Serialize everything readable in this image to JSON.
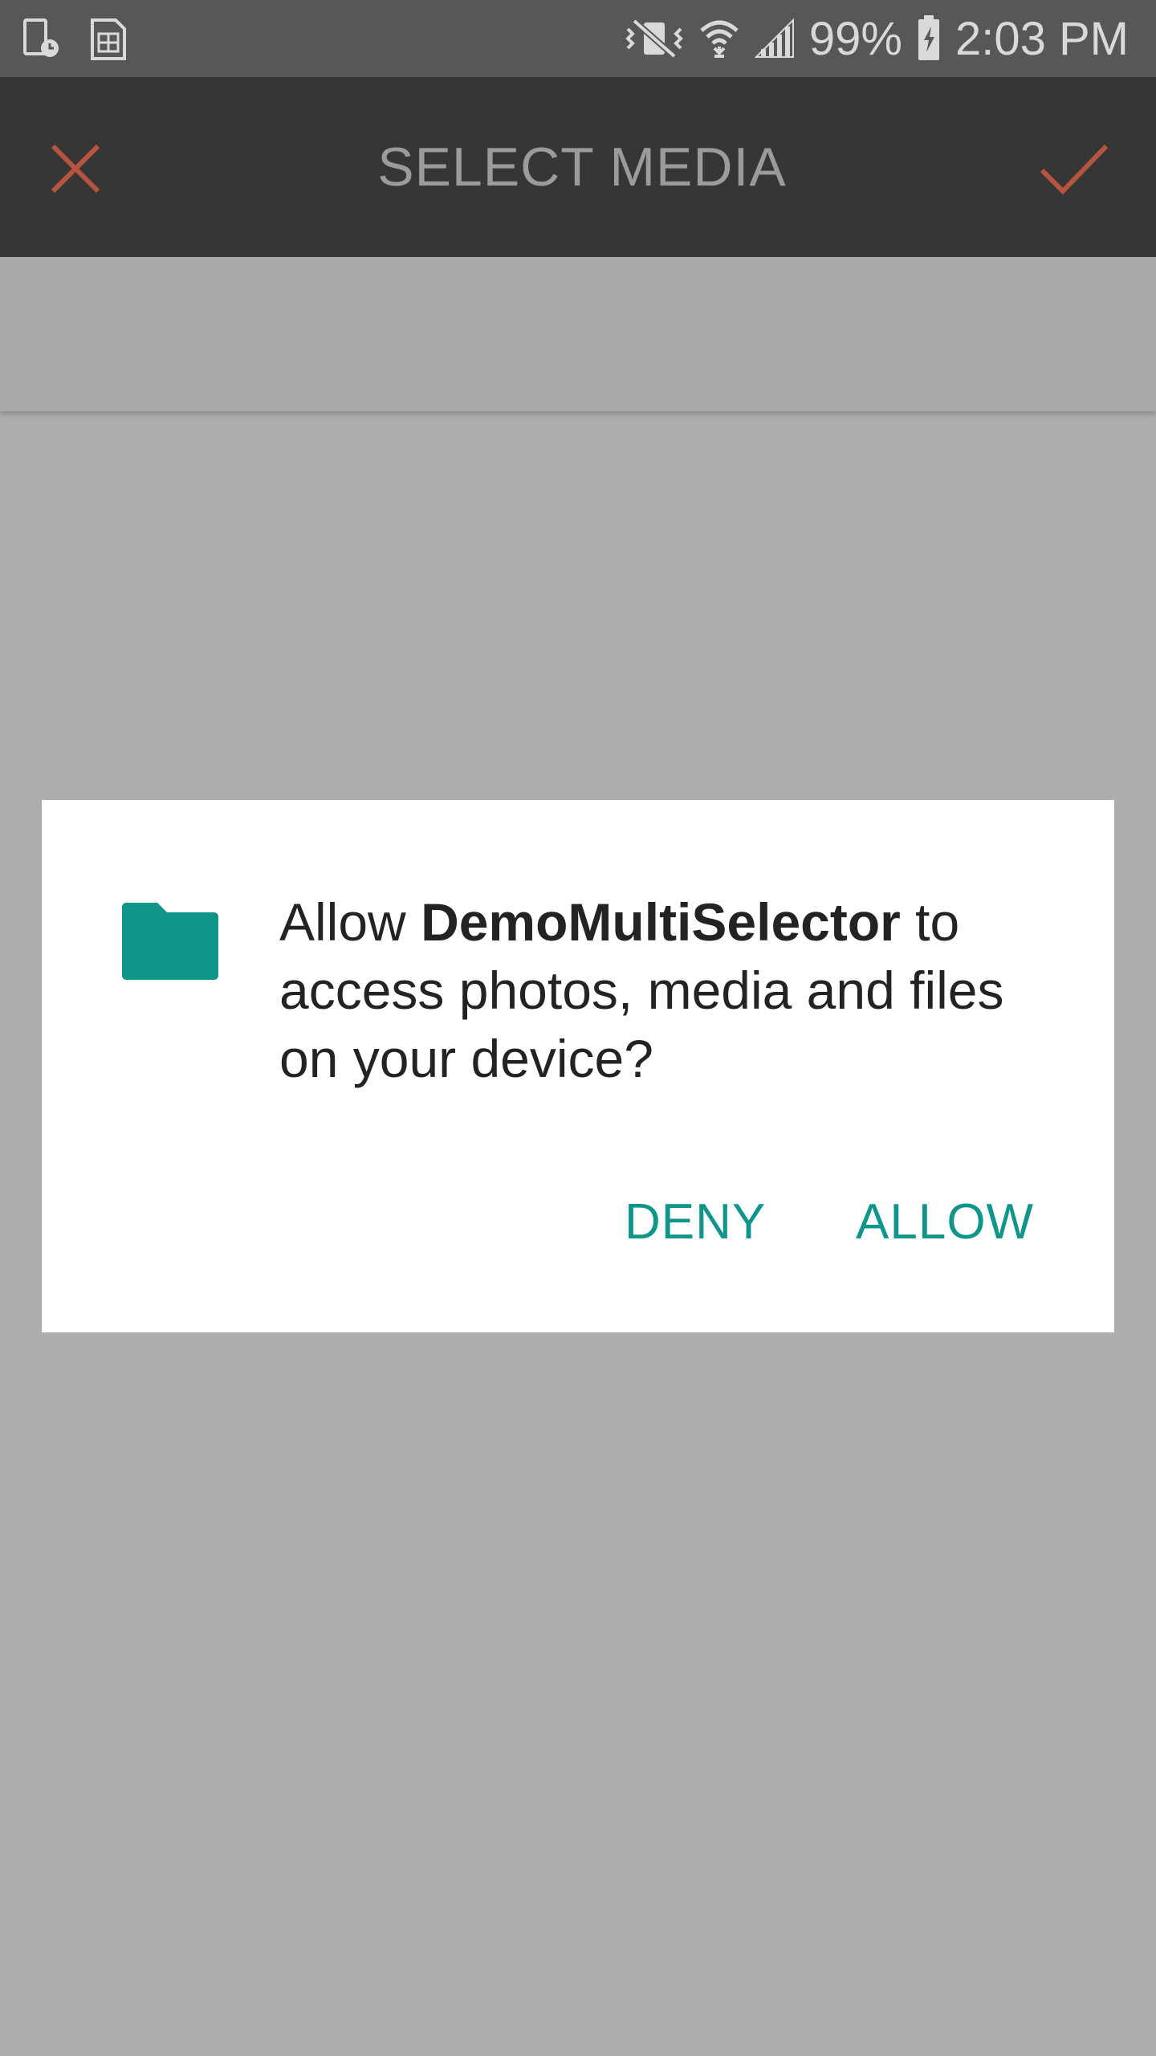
{
  "status_bar": {
    "battery": "99%",
    "time": "2:03 PM",
    "icons": [
      "screenshot-clock-icon",
      "sim-card-icon",
      "vibrate-mute-icon",
      "wifi-icon",
      "signal-icon",
      "battery-charging-icon"
    ]
  },
  "toolbar": {
    "title": "SELECT MEDIA",
    "close_icon": "close-icon",
    "confirm_icon": "check-icon",
    "accent_color": "#b5553f"
  },
  "dialog": {
    "icon": "folder-icon",
    "icon_color": "#0f958a",
    "text_prefix": "Allow ",
    "app_name": "DemoMultiSelector",
    "text_suffix": " to access photos, media and files on your device?",
    "deny_label": "DENY",
    "allow_label": "ALLOW",
    "button_color": "#0f958a"
  }
}
